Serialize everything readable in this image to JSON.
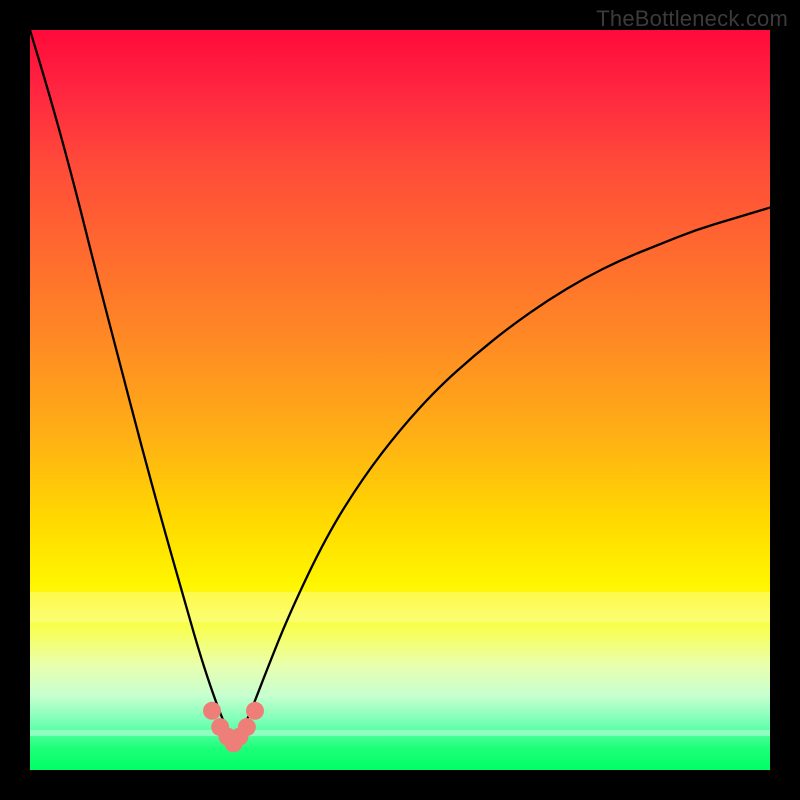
{
  "watermark": {
    "text": "TheBottleneck.com"
  },
  "colors": {
    "page_bg": "#000000",
    "curve": "#000000",
    "marker_fill": "#ed7f78",
    "marker_stroke": "#cc6a63"
  },
  "chart_data": {
    "type": "line",
    "title": "",
    "xlabel": "",
    "ylabel": "",
    "xlim": [
      0,
      100
    ],
    "ylim": [
      0,
      100
    ],
    "grid": false,
    "legend": false,
    "trough_x": 27.5,
    "series": [
      {
        "name": "bottleneck-curve",
        "x": [
          0,
          3,
          6,
          9,
          12,
          15,
          18,
          21,
          23,
          25,
          26.5,
          27.5,
          28.5,
          30,
          32,
          35,
          40,
          45,
          50,
          55,
          60,
          65,
          70,
          75,
          80,
          85,
          90,
          95,
          100
        ],
        "y": [
          100,
          90,
          79,
          67,
          55.5,
          44,
          33,
          22.5,
          15.5,
          9.5,
          5.7,
          4.2,
          5.0,
          8.3,
          13.5,
          21,
          31.5,
          39.5,
          46,
          51.5,
          56,
          60,
          63.5,
          66.5,
          69,
          71,
          73,
          74.5,
          76
        ]
      }
    ],
    "markers": {
      "name": "trough-points",
      "x": [
        24.6,
        25.7,
        26.7,
        28.3,
        29.3,
        30.4,
        27.5
      ],
      "y": [
        8.0,
        5.8,
        4.5,
        4.5,
        5.8,
        8.0,
        3.6
      ]
    }
  }
}
